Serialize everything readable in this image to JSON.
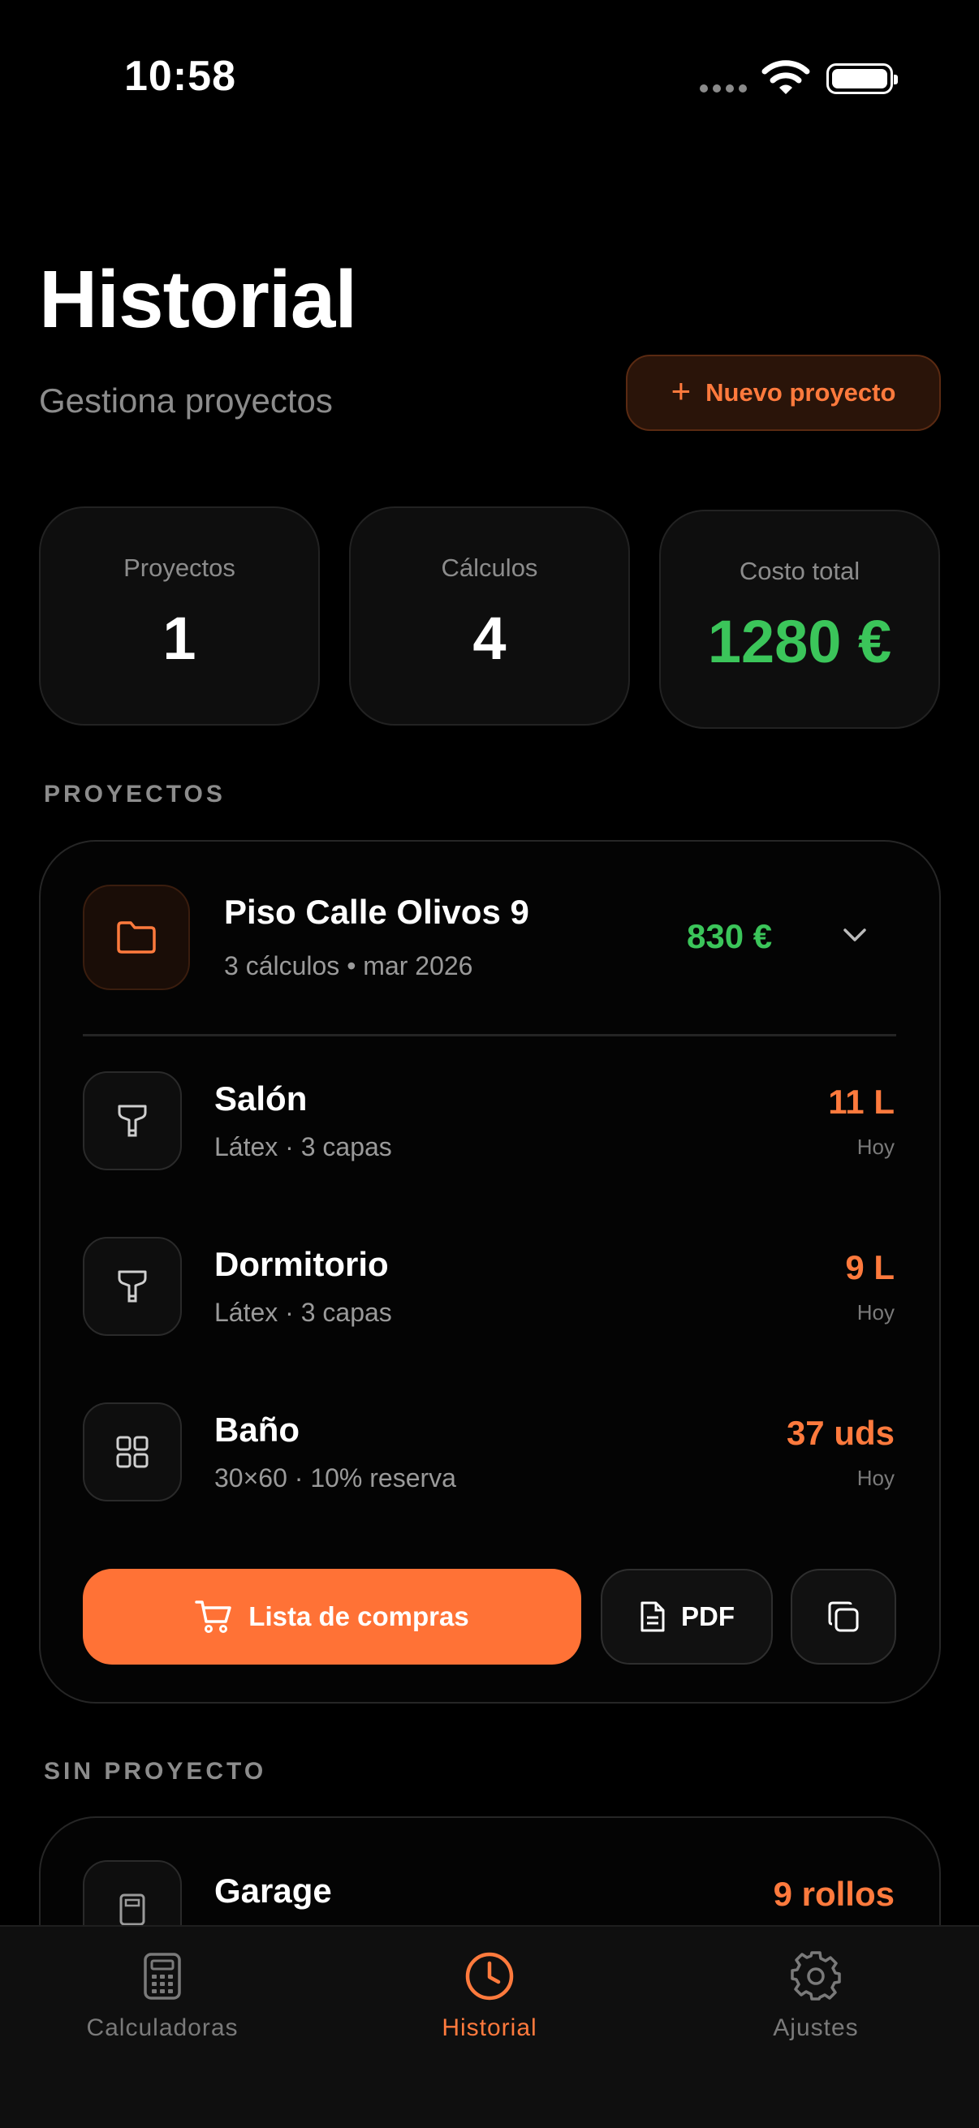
{
  "status_bar": {
    "time": "10:58"
  },
  "header": {
    "title": "Historial",
    "subtitle": "Gestiona proyectos",
    "new_project_label": "Nuevo proyecto"
  },
  "stats": [
    {
      "label": "Proyectos",
      "value": "1"
    },
    {
      "label": "Cálculos",
      "value": "4"
    },
    {
      "label": "Costo total",
      "value": "1280 €"
    }
  ],
  "sections": {
    "projects": "PROYECTOS",
    "no_project": "SIN PROYECTO"
  },
  "project": {
    "name": "Piso Calle Olivos 9",
    "meta": "3 cálculos • mar 2026",
    "cost": "830 €",
    "items": [
      {
        "name": "Salón",
        "desc": "Látex · 3 capas",
        "qty": "11 L",
        "when": "Hoy",
        "icon": "paint-roller-icon"
      },
      {
        "name": "Dormitorio",
        "desc": "Látex · 3 capas",
        "qty": "9 L",
        "when": "Hoy",
        "icon": "paint-roller-icon"
      },
      {
        "name": "Baño",
        "desc": "30×60 · 10% reserva",
        "qty": "37 uds",
        "when": "Hoy",
        "icon": "tiles-grid-icon"
      }
    ],
    "actions": {
      "shopping_list": "Lista de compras",
      "pdf": "PDF"
    }
  },
  "loose_items": [
    {
      "name": "Garage",
      "qty": "9 rollos",
      "icon": "calculator-icon"
    }
  ],
  "tabs": [
    {
      "label": "Calculadoras",
      "icon": "calculator-icon",
      "active": false
    },
    {
      "label": "Historial",
      "icon": "clock-icon",
      "active": true
    },
    {
      "label": "Ajustes",
      "icon": "gear-icon",
      "active": false
    }
  ],
  "colors": {
    "accent": "#ff7236",
    "green": "#3bc55a",
    "background": "#000000"
  }
}
